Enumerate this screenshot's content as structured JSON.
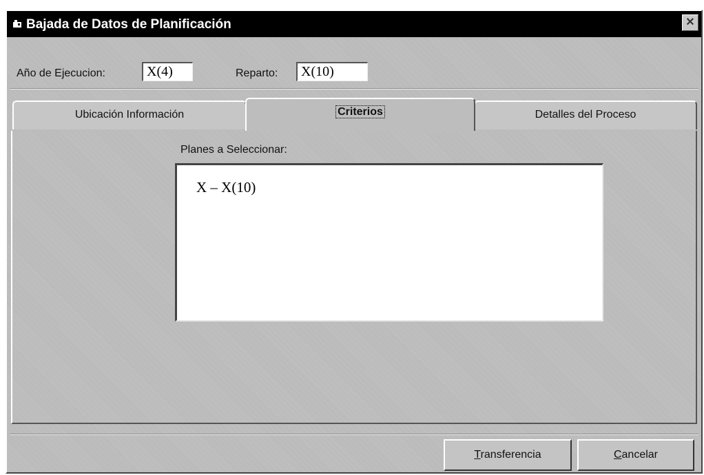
{
  "window": {
    "title": "Bajada de Datos de Planificación",
    "close_glyph": "✕"
  },
  "header": {
    "anio_label": "Año de Ejecucion:",
    "anio_value": "X(4)",
    "reparto_label": "Reparto:",
    "reparto_value": "X(10)"
  },
  "tabs": [
    {
      "label": "Ubicación Información",
      "active": false
    },
    {
      "label": "Criterios",
      "active": true
    },
    {
      "label": "Detalles del Proceso",
      "active": false
    }
  ],
  "criterios": {
    "planes_label": "Planes a Seleccionar:",
    "planes_items": [
      "X – X(10)"
    ]
  },
  "buttons": {
    "transferencia_first": "T",
    "transferencia_rest": "ransferencia",
    "cancelar_first": "C",
    "cancelar_rest": "ancelar"
  },
  "colors": {
    "titlebar": "#000000",
    "face": "#bfbfbf"
  }
}
